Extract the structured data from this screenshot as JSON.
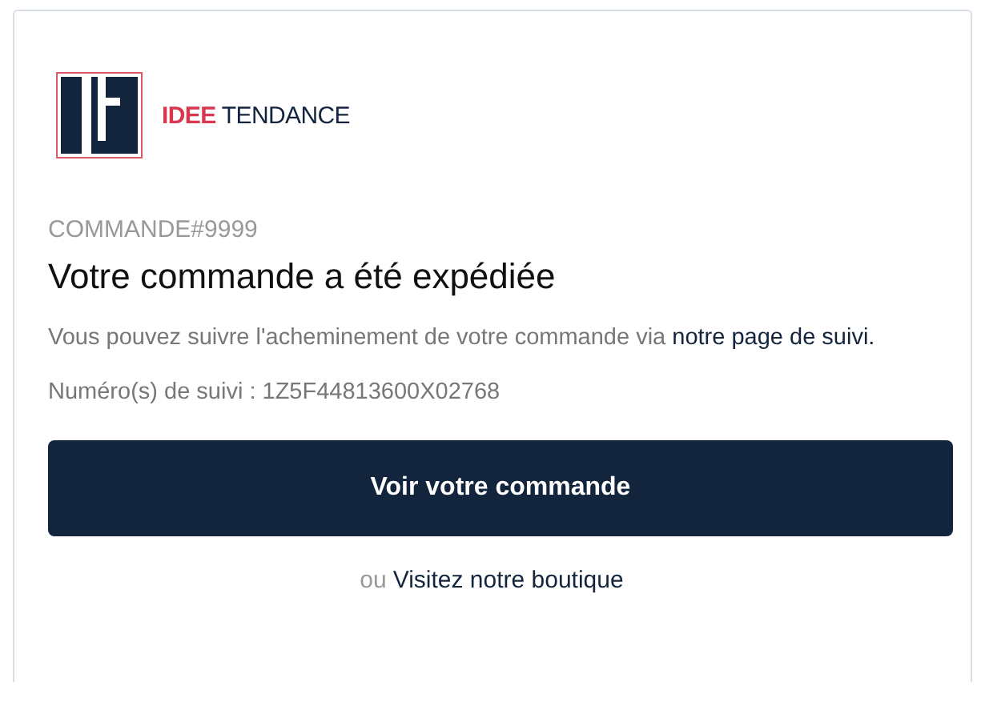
{
  "brand": {
    "name": "**IDEE** TENDANCE"
  },
  "order": {
    "label": "COMMANDE#9999",
    "title": "Votre commande a été expédiée"
  },
  "message": {
    "text": "Vous pouvez suivre l'acheminement de votre commande via ",
    "link": "notre page de suivi."
  },
  "tracking": "Numéro(s) de suivi : 1Z5F44813600X02768",
  "button": "Voir votre commande",
  "footer": {
    "prefix": "ou",
    "link": "Visitez notre boutique"
  }
}
